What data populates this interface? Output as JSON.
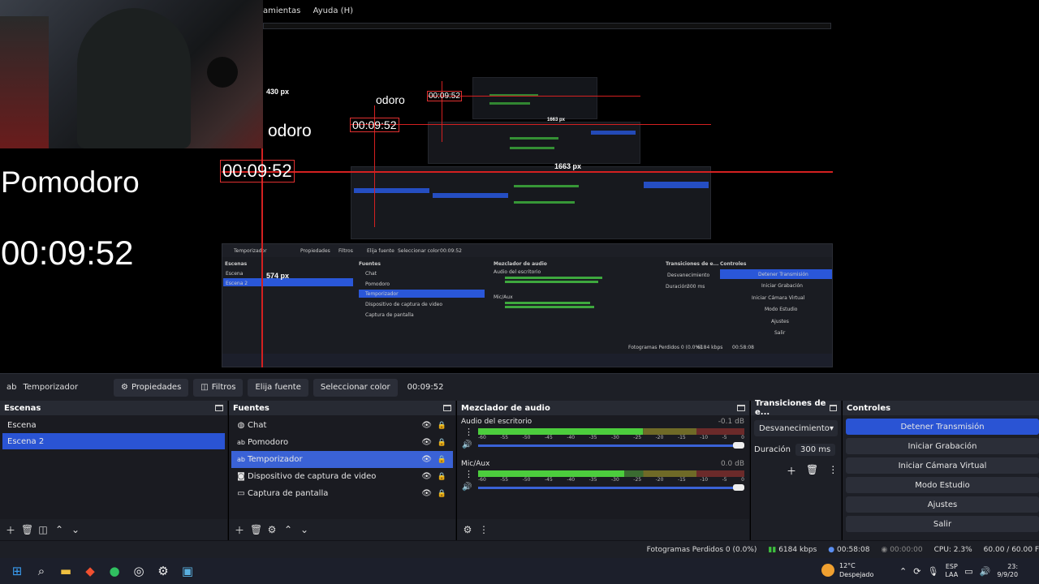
{
  "preview": {
    "menu": [
      "amientas",
      "Ayuda (H)"
    ],
    "overlay_pomodoro": "Pomodoro",
    "overlay_timer": "00:09:52",
    "nested_timer_1": "00:09:52",
    "nested_timer_2": "00:09:52",
    "nested_timer_3": "00:09:52",
    "nested_pomodoro_1": "odoro",
    "nested_pomodoro_2": "odoro",
    "px_430": "430 px",
    "px_574": "574 px",
    "px_1663_a": "1663 px",
    "px_1663_b": "1663 px",
    "mini_source_name": "Temporizador",
    "mini_buttons": [
      "Propiedades",
      "Filtros",
      "Elija fuente",
      "Seleccionar color",
      "00:09:52"
    ],
    "mini_docks": [
      "Escenas",
      "Fuentes",
      "Mezclador de audio",
      "Transiciones de e...",
      "Controles"
    ],
    "mini_scenes": [
      "Escena",
      "Escena 2"
    ],
    "mini_sources": [
      "Chat",
      "Pomodoro",
      "Temporizador",
      "Dispositivo de captura de video",
      "Captura de pantalla"
    ],
    "mini_channels": [
      "Audio del escritorio",
      "Mic/Aux"
    ],
    "mini_trans": [
      "Desvanecimiento",
      "Duración",
      "300 ms"
    ],
    "mini_controls": [
      "Detener Transmisión",
      "Iniciar Grabación",
      "Iniciar Cámara Virtual",
      "Modo Estudio",
      "Ajustes",
      "Salir"
    ],
    "mini_status": [
      "Fotogramas Perdidos 0 (0.0%)",
      "6184 kbps",
      "00:58:08"
    ]
  },
  "toolbar": {
    "source_name": "Temporizador",
    "properties": "Propiedades",
    "filters": "Filtros",
    "choose_source": "Elija fuente",
    "select_color": "Seleccionar color",
    "timer_value": "00:09:52"
  },
  "scenes": {
    "title": "Escenas",
    "items": [
      "Escena",
      "Escena 2"
    ],
    "selected": 1
  },
  "sources": {
    "title": "Fuentes",
    "items": [
      {
        "label": "Chat",
        "icon": "globe-icon"
      },
      {
        "label": "Pomodoro",
        "icon": "text-icon"
      },
      {
        "label": "Temporizador",
        "icon": "text-icon"
      },
      {
        "label": "Dispositivo de captura de video",
        "icon": "camera-icon"
      },
      {
        "label": "Captura de pantalla",
        "icon": "monitor-icon"
      }
    ],
    "selected": 2
  },
  "mixer": {
    "title": "Mezclador de audio",
    "channels": [
      {
        "name": "Audio del escritorio",
        "db": "-0.1 dB",
        "level": 0.62
      },
      {
        "name": "Mic/Aux",
        "db": "0.0 dB",
        "level": 0.55
      }
    ],
    "ticks": [
      "-60",
      "-55",
      "-50",
      "-45",
      "-40",
      "-35",
      "-30",
      "-25",
      "-20",
      "-15",
      "-10",
      "-5",
      "0"
    ]
  },
  "transitions": {
    "title": "Transiciones de e...",
    "selected": "Desvanecimiento",
    "duration_label": "Duración",
    "duration_value": "300 ms"
  },
  "controls": {
    "title": "Controles",
    "stop_stream": "Detener Transmisión",
    "start_recording": "Iniciar Grabación",
    "start_virtual_cam": "Iniciar Cámara Virtual",
    "studio_mode": "Modo Estudio",
    "settings": "Ajustes",
    "exit": "Salir"
  },
  "status": {
    "dropped_frames": "Fotogramas Perdidos 0 (0.0%)",
    "bitrate": "6184 kbps",
    "stream_time": "00:58:08",
    "record_time": "00:00:00",
    "cpu": "CPU: 2.3%",
    "fps": "60.00 / 60.00 F"
  },
  "taskbar": {
    "temperature": "12°C",
    "weather": "Despejado",
    "lang_1": "ESP",
    "lang_2": "LAA",
    "time": "23:",
    "date": "9/9/20"
  },
  "colors": {
    "accent": "#2a54d4",
    "panel": "#1d1f26",
    "guide": "#d42020",
    "meter_green": "#4ccd3d"
  }
}
